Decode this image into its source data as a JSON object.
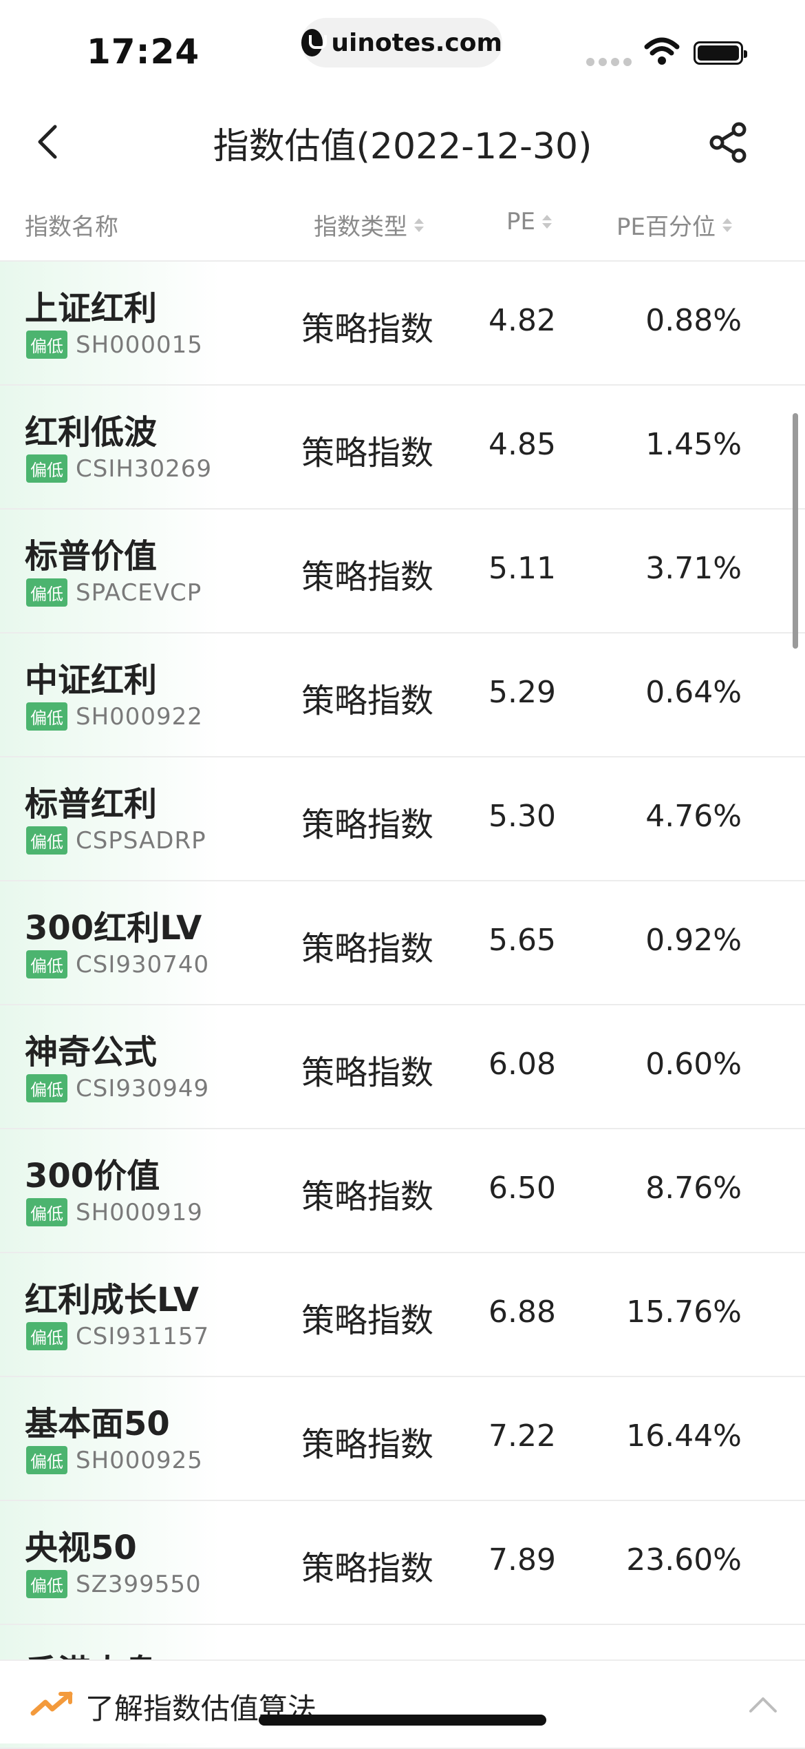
{
  "status_bar": {
    "time": "17:24",
    "url": "uinotes.com"
  },
  "nav": {
    "title": "指数估值(2022-12-30)"
  },
  "table": {
    "headers": {
      "name": "指数名称",
      "type": "指数类型",
      "pe": "PE",
      "pct": "PE百分位"
    },
    "rows": [
      {
        "name": "上证红利",
        "tag": "偏低",
        "code": "SH000015",
        "type": "策略指数",
        "pe": "4.82",
        "pct": "0.88%"
      },
      {
        "name": "红利低波",
        "tag": "偏低",
        "code": "CSIH30269",
        "type": "策略指数",
        "pe": "4.85",
        "pct": "1.45%"
      },
      {
        "name": "标普价值",
        "tag": "偏低",
        "code": "SPACEVCP",
        "type": "策略指数",
        "pe": "5.11",
        "pct": "3.71%"
      },
      {
        "name": "中证红利",
        "tag": "偏低",
        "code": "SH000922",
        "type": "策略指数",
        "pe": "5.29",
        "pct": "0.64%"
      },
      {
        "name": "标普红利",
        "tag": "偏低",
        "code": "CSPSADRP",
        "type": "策略指数",
        "pe": "5.30",
        "pct": "4.76%"
      },
      {
        "name": "300红利LV",
        "tag": "偏低",
        "code": "CSI930740",
        "type": "策略指数",
        "pe": "5.65",
        "pct": "0.92%"
      },
      {
        "name": "神奇公式",
        "tag": "偏低",
        "code": "CSI930949",
        "type": "策略指数",
        "pe": "6.08",
        "pct": "0.60%"
      },
      {
        "name": "300价值",
        "tag": "偏低",
        "code": "SH000919",
        "type": "策略指数",
        "pe": "6.50",
        "pct": "8.76%"
      },
      {
        "name": "红利成长LV",
        "tag": "偏低",
        "code": "CSI931157",
        "type": "策略指数",
        "pe": "6.88",
        "pct": "15.76%"
      },
      {
        "name": "基本面50",
        "tag": "偏低",
        "code": "SH000925",
        "type": "策略指数",
        "pe": "7.22",
        "pct": "16.44%"
      },
      {
        "name": "央视50",
        "tag": "偏低",
        "code": "SZ399550",
        "type": "策略指数",
        "pe": "7.89",
        "pct": "23.60%"
      },
      {
        "name": "香港大盘",
        "tag": "",
        "code": "",
        "type": "",
        "pe": "",
        "pct": ""
      }
    ]
  },
  "bottom_bar": {
    "label": "了解指数估值算法"
  },
  "colors": {
    "tag_green": "#4cb46f",
    "row_highlight": "#e8f8ed",
    "header_text": "#8a8a8a"
  },
  "icons": [
    "back-icon",
    "share-icon",
    "sort-icon",
    "trend-icon",
    "chevron-up-icon",
    "wifi-icon",
    "battery-icon"
  ]
}
